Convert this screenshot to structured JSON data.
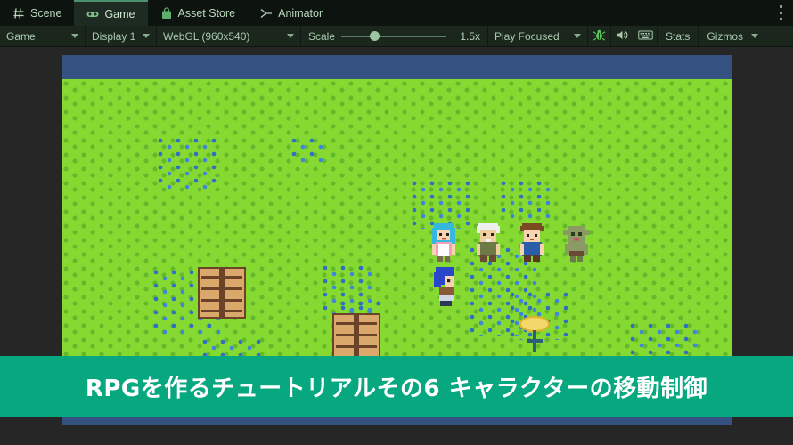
{
  "window": {
    "background_color": "#262626",
    "kebab_icon": "kebab-menu-icon"
  },
  "tabs": [
    {
      "label": "Scene",
      "icon": "grid-icon",
      "active": false
    },
    {
      "label": "Game",
      "icon": "gamepad-icon",
      "active": true
    },
    {
      "label": "Asset Store",
      "icon": "shopping-bag-icon",
      "active": false
    },
    {
      "label": "Animator",
      "icon": "animator-node-icon",
      "active": false
    }
  ],
  "toolbar": {
    "target_display_group": "Game",
    "display": "Display 1",
    "aspect": "WebGL (960x540)",
    "scale_label": "Scale",
    "scale_value": "1.5x",
    "scale_percent": 27,
    "play_mode": "Play Focused",
    "bug_icon": "bug-icon",
    "mute_icon": "speaker-icon",
    "keyboard_icon": "keyboard-icon",
    "stats_label": "Stats",
    "gizmos_label": "Gizmos"
  },
  "game": {
    "sky_color": "#345181",
    "grass_color": "#86d931",
    "grass_tuft_color": "#63b92a",
    "flower_color": "#2f6fc4",
    "wood_color": "#d9a86a",
    "wood_dark_color": "#6b4328",
    "torch_color": "#f2d76a"
  },
  "caption": {
    "text": "RPGを作るチュートリアルその6 キャラクターの移動制御",
    "background_color": "#07a880",
    "text_color": "#ffffff"
  }
}
